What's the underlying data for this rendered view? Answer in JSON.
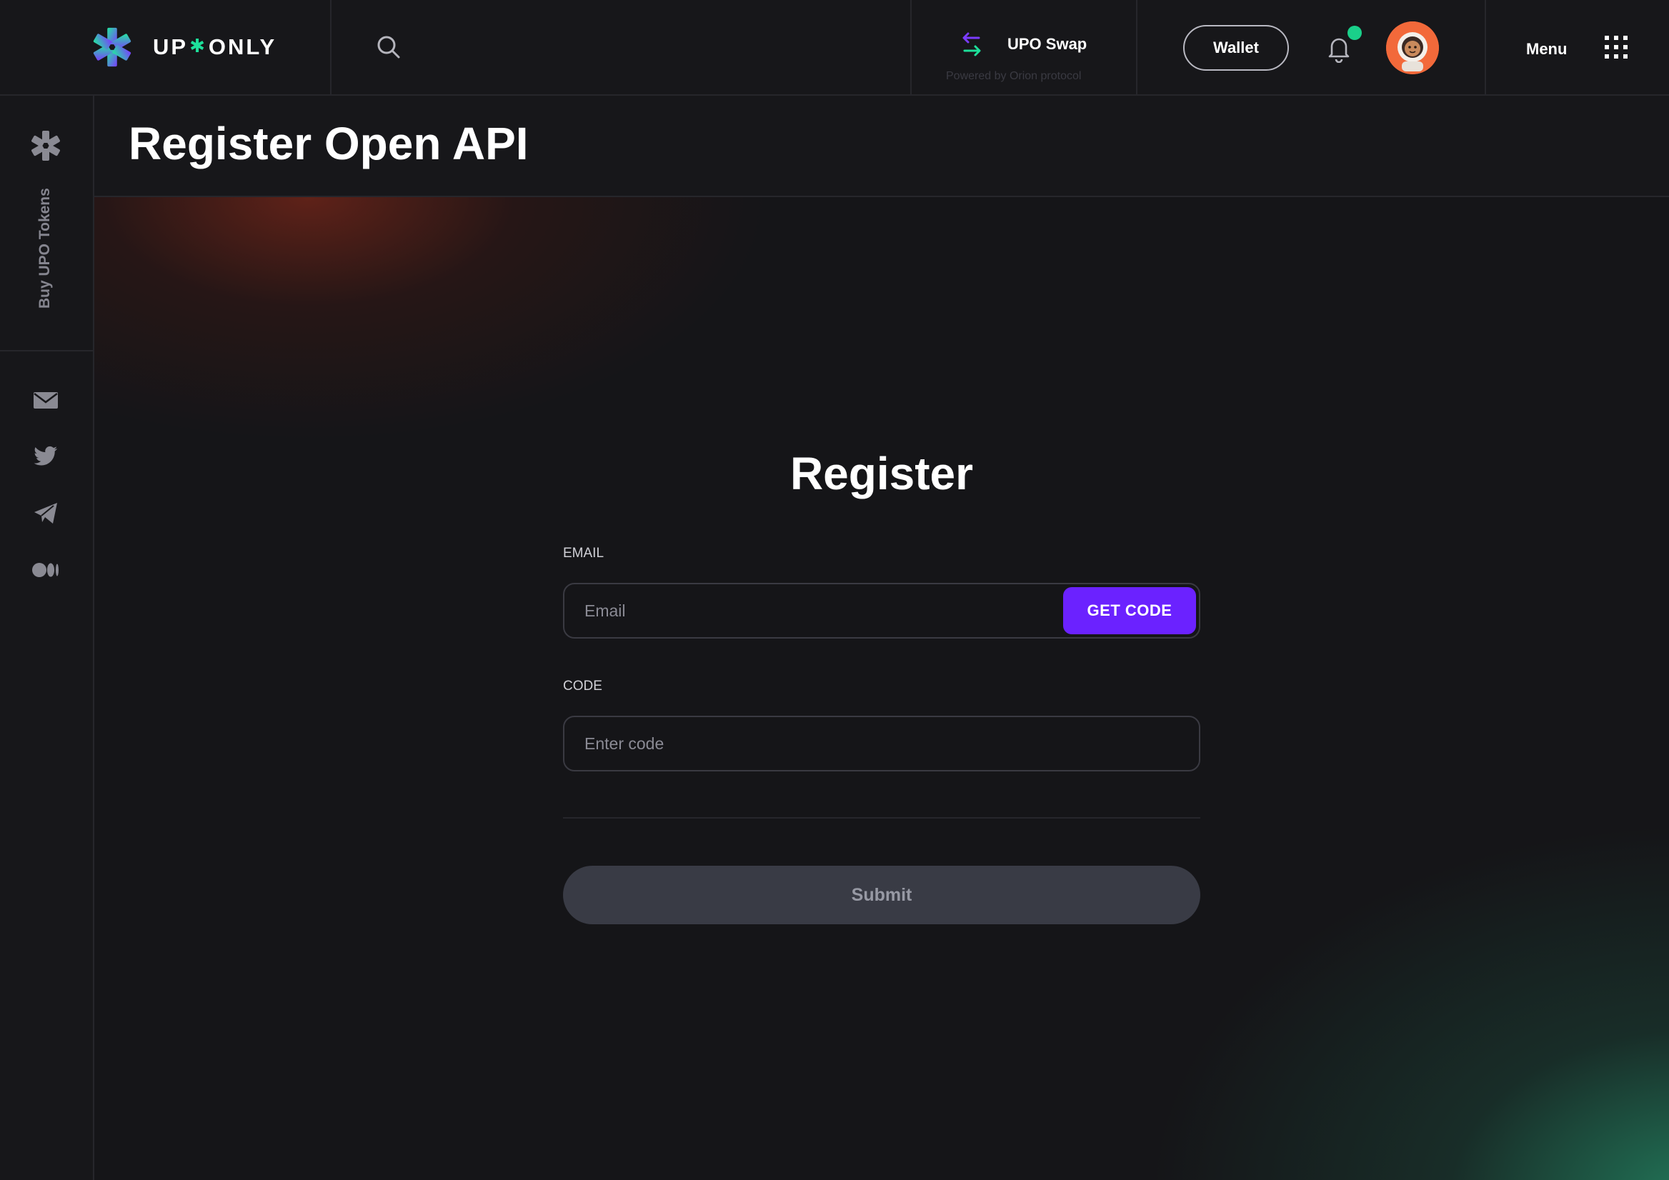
{
  "header": {
    "brand": {
      "text_left": "UP",
      "text_right": "ONLY",
      "separator": "✱"
    },
    "swap": {
      "title": "UPO Swap",
      "subtitle": "Powered by Orion protocol"
    },
    "wallet_label": "Wallet",
    "menu_label": "Menu"
  },
  "sidebar": {
    "buy_tokens_label": "Buy UPO Tokens",
    "social": [
      "mail-icon",
      "twitter-icon",
      "telegram-icon",
      "medium-icon"
    ]
  },
  "page": {
    "title": "Register Open API"
  },
  "form": {
    "title": "Register",
    "email": {
      "label": "EMAIL",
      "placeholder": "Email",
      "value": "",
      "button": "GET CODE"
    },
    "code": {
      "label": "CODE",
      "placeholder": "Enter code",
      "value": ""
    },
    "submit_label": "Submit"
  },
  "colors": {
    "accent": "#6b22ff",
    "brand_green": "#1ddf9a",
    "notification": "#1ad08a",
    "background": "#151518"
  }
}
